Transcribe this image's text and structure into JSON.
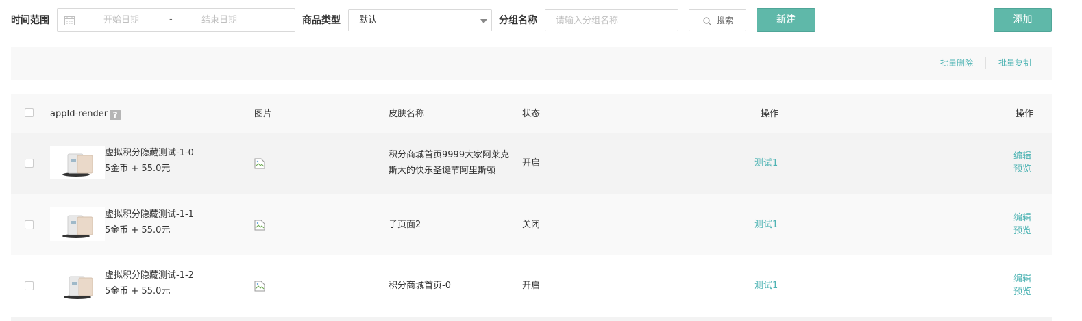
{
  "filters": {
    "time_label": "时间范围",
    "start_placeholder": "开始日期",
    "date_separator": "-",
    "end_placeholder": "结束日期",
    "type_label": "商品类型",
    "type_value": "默认",
    "group_label": "分组名称",
    "group_placeholder": "请输入分组名称",
    "search_label": "搜索",
    "new_label": "新建",
    "add_label": "添加"
  },
  "batch": {
    "delete_label": "批量删除",
    "copy_label": "批量复制"
  },
  "table": {
    "headers": {
      "appid": "appId-render",
      "help": "?",
      "image": "图片",
      "skin": "皮肤名称",
      "status": "状态",
      "op1": "操作",
      "op2": "操作"
    },
    "rows": [
      {
        "name": "虚拟积分隐藏测试-1-0",
        "price": "5金币 + 55.0元",
        "skin": "积分商城首页9999大家阿莱克斯大的快乐圣诞节阿里斯顿",
        "status": "开启",
        "test": "测试1",
        "edit": "编辑",
        "preview": "预览"
      },
      {
        "name": "虚拟积分隐藏测试-1-1",
        "price": "5金币 + 55.0元",
        "skin": "子页面2",
        "status": "关闭",
        "test": "测试1",
        "edit": "编辑",
        "preview": "预览"
      },
      {
        "name": "虚拟积分隐藏测试-1-2",
        "price": "5金币 + 55.0元",
        "skin": "积分商城首页-0",
        "status": "开启",
        "test": "测试1",
        "edit": "编辑",
        "preview": "预览"
      }
    ]
  },
  "colors": {
    "accent": "#5fb8a9",
    "link": "#4db3b3"
  },
  "icons": [
    "calendar-icon",
    "search-icon",
    "chevron-down-icon",
    "help-icon",
    "broken-image-icon",
    "product-thumbnail"
  ]
}
